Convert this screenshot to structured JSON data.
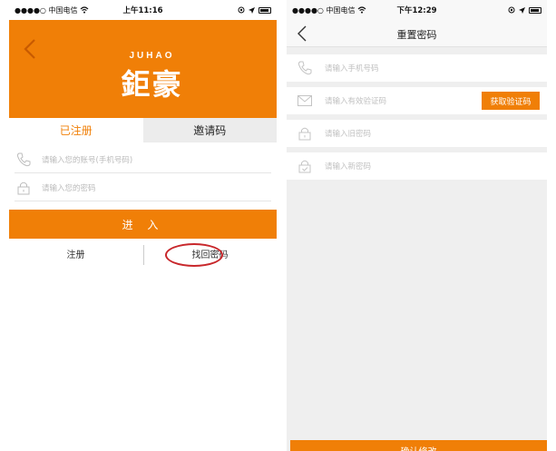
{
  "left": {
    "status": {
      "carrier": "●●●●○ 中国电信",
      "time": "上午11:16"
    },
    "brand": {
      "latin": "JUHAO",
      "chinese": "鉅豪"
    },
    "tabs": [
      {
        "label": "已注册",
        "active": true
      },
      {
        "label": "邀请码",
        "active": false
      }
    ],
    "fields": {
      "account_placeholder": "请输入您的账号(手机号码)",
      "password_placeholder": "请输入您的密码"
    },
    "login_label": "进 入",
    "links": {
      "register": "注册",
      "forgot": "找回密码"
    }
  },
  "right": {
    "status": {
      "carrier": "●●●●○ 中国电信",
      "time": "下午12:29"
    },
    "title": "重置密码",
    "rows": {
      "phone_placeholder": "请输入手机号码",
      "code_placeholder": "请输入有效验证码",
      "old_placeholder": "请输入旧密码",
      "new_placeholder": "请输入新密码"
    },
    "get_code_label": "获取验证码",
    "confirm_label": "确认修改"
  },
  "colors": {
    "accent": "#f07f07",
    "highlight": "#c8272b"
  },
  "icons": [
    "back-chevron-icon",
    "phone-icon",
    "lock-icon",
    "mail-icon",
    "lock-check-icon",
    "wifi-icon",
    "battery-icon",
    "location-icon"
  ]
}
